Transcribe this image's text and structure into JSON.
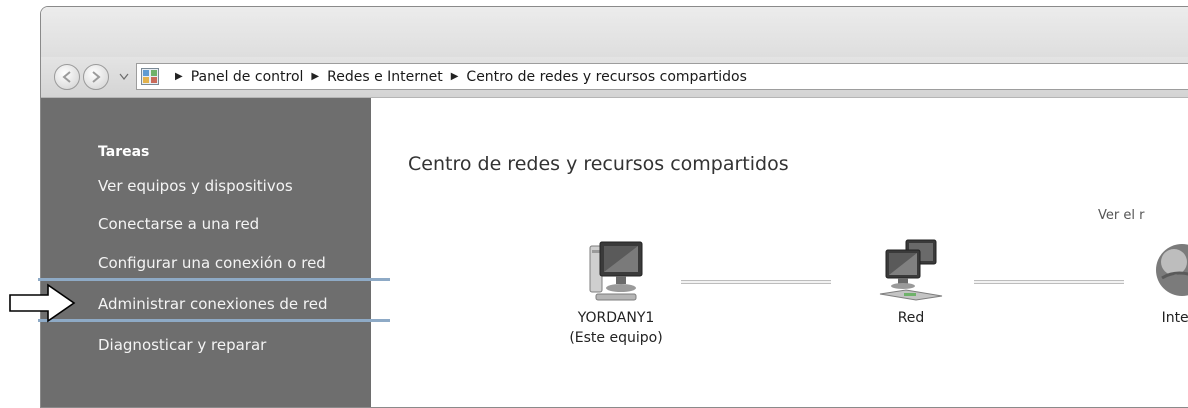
{
  "breadcrumb": [
    "Panel de control",
    "Redes e Internet",
    "Centro de redes y recursos compartidos"
  ],
  "sidebar": {
    "title": "Tareas",
    "items": [
      {
        "label": "Ver equipos y dispositivos"
      },
      {
        "label": "Conectarse a una red"
      },
      {
        "label": "Configurar una conexión o red"
      },
      {
        "label": "Administrar conexiones de red"
      },
      {
        "label": "Diagnosticar y reparar"
      }
    ]
  },
  "main": {
    "title": "Centro de redes y recursos compartidos",
    "view_link": "Ver el r",
    "nodes": [
      {
        "name": "YORDANY1",
        "sub": "(Este equipo)",
        "icon": "computer-icon"
      },
      {
        "name": "Red",
        "icon": "network-icon"
      },
      {
        "name": "Inter",
        "icon": "internet-globe-icon"
      }
    ]
  },
  "annotation": {
    "highlight_color": "#8eaac6",
    "pointer_target": "Administrar conexiones de red"
  },
  "colors": {
    "sidebar_bg": "#6e6e6e",
    "toolbar_bg": "#dcdcdc"
  }
}
